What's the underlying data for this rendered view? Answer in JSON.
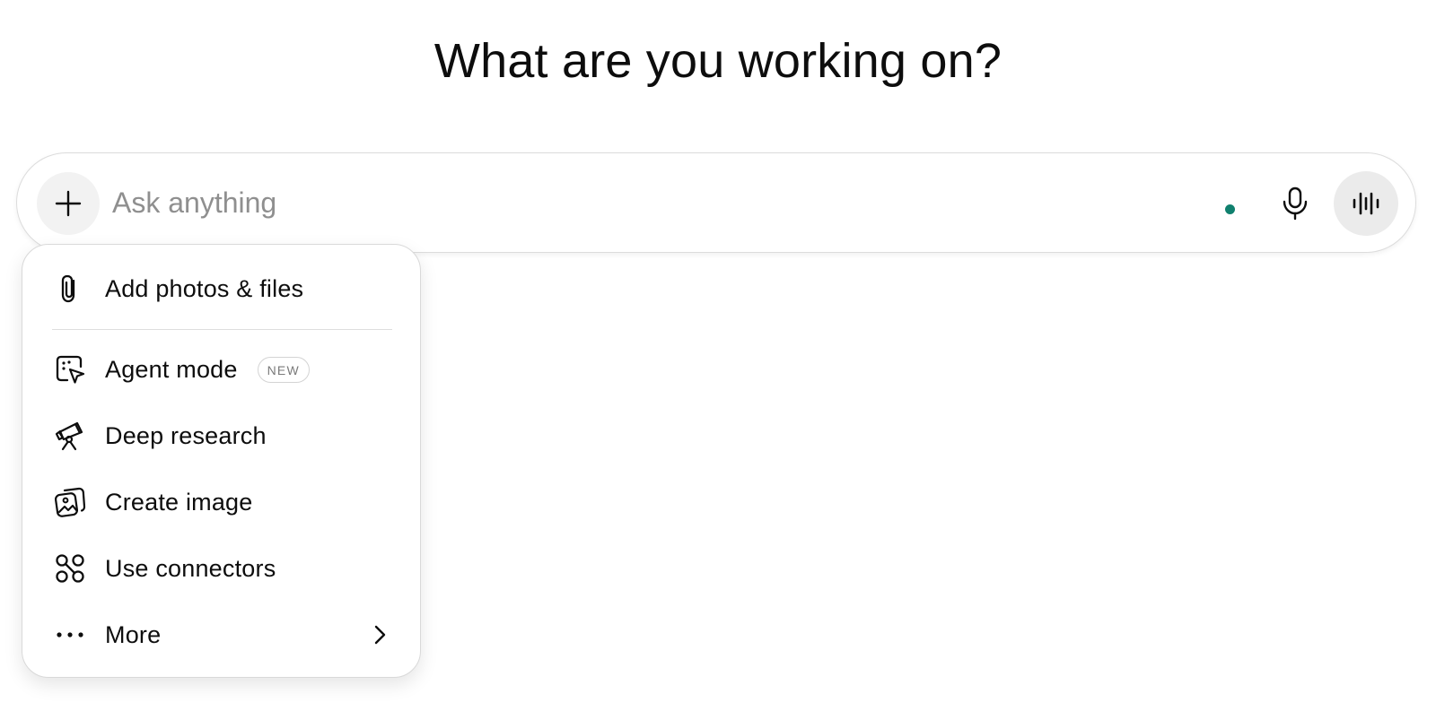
{
  "heading": "What are you working on?",
  "composer": {
    "placeholder": "Ask anything",
    "status_dot_color": "#10806e",
    "icons": {
      "plus": "plus-icon",
      "mic": "microphone-icon",
      "voice": "voice-waveform-icon"
    }
  },
  "menu": {
    "items": [
      {
        "label": "Add photos & files",
        "icon": "paperclip-icon"
      },
      {
        "label": "Agent mode",
        "icon": "agent-cursor-icon",
        "badge": "NEW"
      },
      {
        "label": "Deep research",
        "icon": "telescope-icon"
      },
      {
        "label": "Create image",
        "icon": "image-icon"
      },
      {
        "label": "Use connectors",
        "icon": "connectors-icon"
      },
      {
        "label": "More",
        "icon": "more-dots-icon",
        "has_submenu": true
      }
    ]
  }
}
